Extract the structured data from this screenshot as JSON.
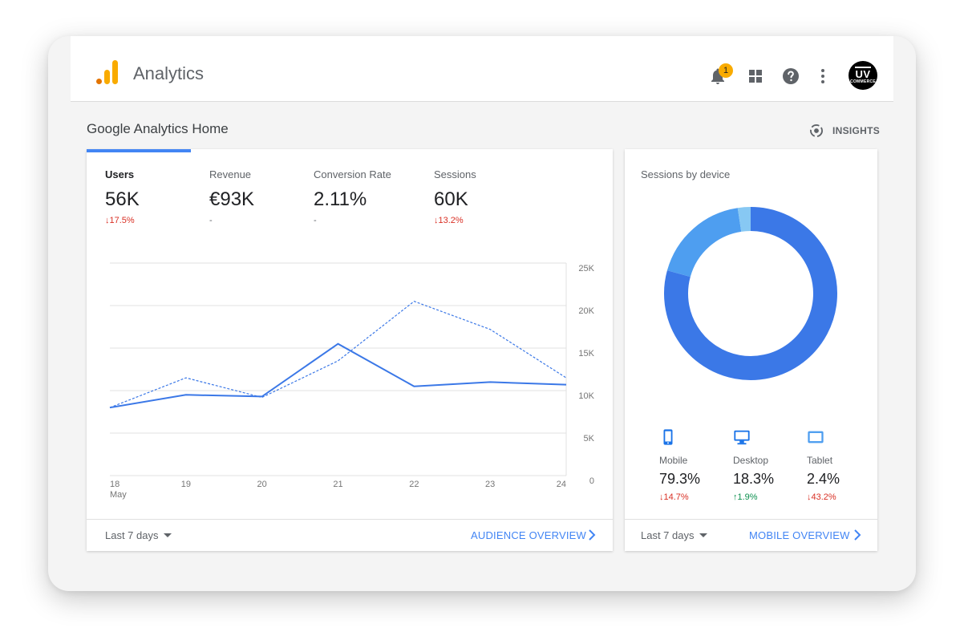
{
  "header": {
    "app_title": "Analytics",
    "notification_count": "1",
    "avatar_text_top": "UV",
    "avatar_text_bottom": "COMMERCE"
  },
  "page": {
    "title": "Google Analytics Home",
    "insights_label": "INSIGHTS"
  },
  "metrics": [
    {
      "label": "Users",
      "value": "56K",
      "delta": "↓17.5%",
      "trend": "down"
    },
    {
      "label": "Revenue",
      "value": "€93K",
      "delta": "-",
      "trend": "none"
    },
    {
      "label": "Conversion Rate",
      "value": "2.11%",
      "delta": "-",
      "trend": "none"
    },
    {
      "label": "Sessions",
      "value": "60K",
      "delta": "↓13.2%",
      "trend": "down"
    }
  ],
  "chart_data": {
    "type": "line",
    "x": [
      "18",
      "19",
      "20",
      "21",
      "22",
      "23",
      "24"
    ],
    "x_sublabel_first": "May",
    "y_ticks": [
      "25K",
      "20K",
      "15K",
      "10K",
      "5K",
      "0"
    ],
    "ylim": [
      0,
      25000
    ],
    "series": [
      {
        "style": "solid",
        "values": [
          8000,
          9500,
          9300,
          15500,
          10500,
          11000,
          10700
        ]
      },
      {
        "style": "dashed",
        "values": [
          8000,
          11500,
          9200,
          13500,
          20500,
          17200,
          11500
        ]
      }
    ],
    "grid": true,
    "colors": {
      "line": "#3b78e7",
      "grid": "#e0e0e0"
    }
  },
  "main_footer": {
    "range_label": "Last 7 days",
    "link_label": "AUDIENCE OVERVIEW"
  },
  "device_card": {
    "title": "Sessions by device",
    "donut": [
      {
        "name": "Mobile",
        "share": 79.3,
        "color": "#3b78e7"
      },
      {
        "name": "Desktop",
        "share": 18.3,
        "color": "#4e9ef0"
      },
      {
        "name": "Tablet",
        "share": 2.4,
        "color": "#87c8f3"
      }
    ],
    "devices": [
      {
        "label": "Mobile",
        "value": "79.3%",
        "delta": "↓14.7%",
        "trend": "down",
        "icon": "phone-icon"
      },
      {
        "label": "Desktop",
        "value": "18.3%",
        "delta": "↑1.9%",
        "trend": "up",
        "icon": "desktop-icon"
      },
      {
        "label": "Tablet",
        "value": "2.4%",
        "delta": "↓43.2%",
        "trend": "down",
        "icon": "tablet-icon"
      }
    ],
    "range_label": "Last 7 days",
    "link_label": "MOBILE OVERVIEW"
  }
}
